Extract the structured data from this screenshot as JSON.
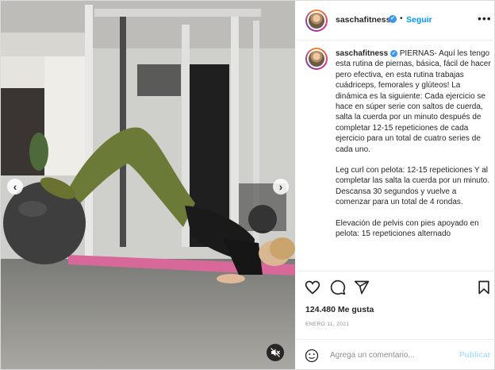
{
  "post": {
    "username": "saschafitness",
    "verified_badge": "✔",
    "follow_label": "Seguir",
    "separator": "•",
    "more_icon": "•••",
    "caption_lead": "PIERNAS- Aquí les tengo esta rutina de piernas, básica, fácil de hacer pero efectiva, en esta rutina trabajas cuádriceps, femorales y glúteos! La dinámica es la siguiente: Cada ejercicio se hace en súper serie con saltos de cuerda, salta la cuerda por un minuto después de completar 12-15 repeticiones de cada ejercicio para un total de cuatro series de cada uno.",
    "caption_p2": "Leg curl con pelota: 12-15 repeticiones Y al completar las salta la cuerda por un minuto. Descansa 30 segundos y vuelve a comenzar para un total de 4 rondas.",
    "caption_p3": "Elevación de pelvis con pies apoyado en pelota: 15 repeticiones alternado",
    "likes": "124.480 Me gusta",
    "date": "ENERO 11, 2021",
    "comment_placeholder": "Agrega un comentario...",
    "publish_label": "Publicar",
    "nav_prev": "‹",
    "nav_next": "›"
  },
  "icons": {
    "like": "heart-icon",
    "comment": "comment-icon",
    "share": "share-icon",
    "save": "bookmark-icon",
    "emoji": "smiley-icon",
    "mute": "muted-speaker-icon"
  },
  "colors": {
    "link_blue": "#0095f6",
    "verified": "#3897f0",
    "publish_disabled": "#b2dffc",
    "text": "#262626",
    "muted": "#8e8e8e"
  }
}
